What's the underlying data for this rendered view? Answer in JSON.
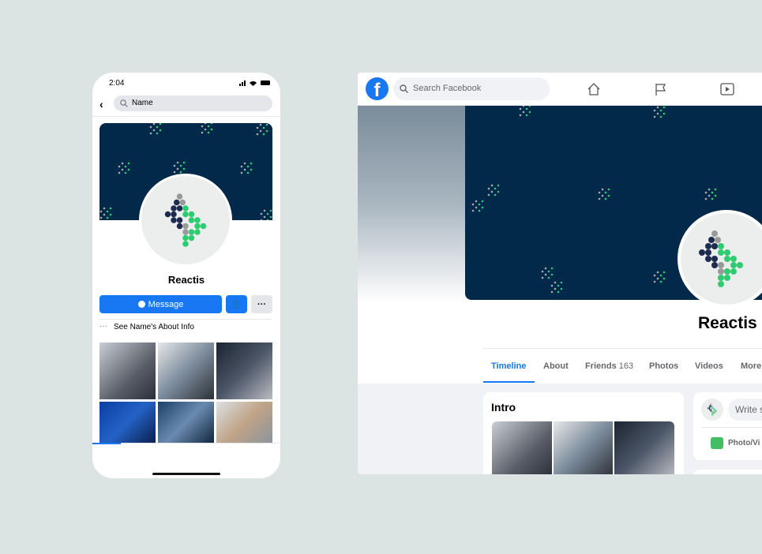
{
  "mobile": {
    "time": "2:04",
    "search_value": "Name",
    "profile_name": "Reactis",
    "message_label": "Message",
    "about_info": "See Name's About Info",
    "nav": [
      "home-icon",
      "video-icon",
      "profile-icon",
      "groups-icon",
      "bell-icon",
      "menu-icon"
    ]
  },
  "desktop": {
    "search_placeholder": "Search Facebook",
    "profile_name": "Reactis",
    "tabs": [
      {
        "label": "Timeline"
      },
      {
        "label": "About"
      },
      {
        "label": "Friends",
        "count": "163"
      },
      {
        "label": "Photos"
      },
      {
        "label": "Videos"
      },
      {
        "label": "More"
      }
    ],
    "intro_title": "Intro",
    "composer_placeholder": "Write s",
    "photo_video_label": "Photo/Vi"
  },
  "colors": {
    "brand": "#1877f2",
    "cover": "#03294a",
    "green": "#2ecc71",
    "background": "#dce3e3"
  }
}
